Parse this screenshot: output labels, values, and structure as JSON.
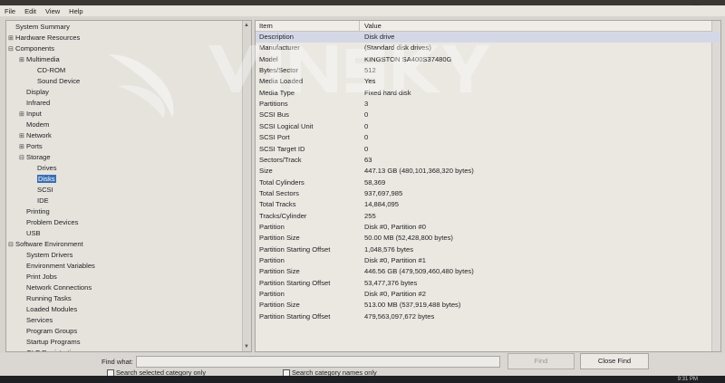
{
  "menu": [
    "File",
    "Edit",
    "View",
    "Help"
  ],
  "tree": [
    {
      "label": "System Summary",
      "level": 0,
      "exp": ""
    },
    {
      "label": "Hardware Resources",
      "level": 0,
      "exp": "⊞"
    },
    {
      "label": "Components",
      "level": 0,
      "exp": "⊟"
    },
    {
      "label": "Multimedia",
      "level": 1,
      "exp": "⊞"
    },
    {
      "label": "CD-ROM",
      "level": 2,
      "exp": ""
    },
    {
      "label": "Sound Device",
      "level": 2,
      "exp": ""
    },
    {
      "label": "Display",
      "level": 1,
      "exp": ""
    },
    {
      "label": "Infrared",
      "level": 1,
      "exp": ""
    },
    {
      "label": "Input",
      "level": 1,
      "exp": "⊞"
    },
    {
      "label": "Modem",
      "level": 1,
      "exp": ""
    },
    {
      "label": "Network",
      "level": 1,
      "exp": "⊞"
    },
    {
      "label": "Ports",
      "level": 1,
      "exp": "⊞"
    },
    {
      "label": "Storage",
      "level": 1,
      "exp": "⊟"
    },
    {
      "label": "Drives",
      "level": 2,
      "exp": ""
    },
    {
      "label": "Disks",
      "level": 2,
      "exp": "",
      "selected": true
    },
    {
      "label": "SCSI",
      "level": 2,
      "exp": ""
    },
    {
      "label": "IDE",
      "level": 2,
      "exp": ""
    },
    {
      "label": "Printing",
      "level": 1,
      "exp": ""
    },
    {
      "label": "Problem Devices",
      "level": 1,
      "exp": ""
    },
    {
      "label": "USB",
      "level": 1,
      "exp": ""
    },
    {
      "label": "Software Environment",
      "level": 0,
      "exp": "⊟"
    },
    {
      "label": "System Drivers",
      "level": 1,
      "exp": ""
    },
    {
      "label": "Environment Variables",
      "level": 1,
      "exp": ""
    },
    {
      "label": "Print Jobs",
      "level": 1,
      "exp": ""
    },
    {
      "label": "Network Connections",
      "level": 1,
      "exp": ""
    },
    {
      "label": "Running Tasks",
      "level": 1,
      "exp": ""
    },
    {
      "label": "Loaded Modules",
      "level": 1,
      "exp": ""
    },
    {
      "label": "Services",
      "level": 1,
      "exp": ""
    },
    {
      "label": "Program Groups",
      "level": 1,
      "exp": ""
    },
    {
      "label": "Startup Programs",
      "level": 1,
      "exp": ""
    },
    {
      "label": "OLE Registration",
      "level": 1,
      "exp": ""
    }
  ],
  "list": {
    "headers": {
      "item": "Item",
      "value": "Value"
    },
    "rows": [
      {
        "item": "Description",
        "value": "Disk drive",
        "selected": true
      },
      {
        "item": "Manufacturer",
        "value": "(Standard disk drives)"
      },
      {
        "item": "Model",
        "value": "KINGSTON SA400S37480G"
      },
      {
        "item": "Bytes/Sector",
        "value": "512"
      },
      {
        "item": "Media Loaded",
        "value": "Yes"
      },
      {
        "item": "Media Type",
        "value": "Fixed hard disk"
      },
      {
        "item": "Partitions",
        "value": "3"
      },
      {
        "item": "SCSI Bus",
        "value": "0"
      },
      {
        "item": "SCSI Logical Unit",
        "value": "0"
      },
      {
        "item": "SCSI Port",
        "value": "0"
      },
      {
        "item": "SCSI Target ID",
        "value": "0"
      },
      {
        "item": "Sectors/Track",
        "value": "63"
      },
      {
        "item": "Size",
        "value": "447.13 GB (480,101,368,320 bytes)"
      },
      {
        "item": "Total Cylinders",
        "value": "58,369"
      },
      {
        "item": "Total Sectors",
        "value": "937,697,985"
      },
      {
        "item": "Total Tracks",
        "value": "14,884,095"
      },
      {
        "item": "Tracks/Cylinder",
        "value": "255"
      },
      {
        "item": "Partition",
        "value": "Disk #0, Partition #0"
      },
      {
        "item": "Partition Size",
        "value": "50.00 MB (52,428,800 bytes)"
      },
      {
        "item": "Partition Starting Offset",
        "value": "1,048,576 bytes"
      },
      {
        "item": "Partition",
        "value": "Disk #0, Partition #1"
      },
      {
        "item": "Partition Size",
        "value": "446.56 GB (479,509,460,480 bytes)"
      },
      {
        "item": "Partition Starting Offset",
        "value": "53,477,376 bytes"
      },
      {
        "item": "Partition",
        "value": "Disk #0, Partition #2"
      },
      {
        "item": "Partition Size",
        "value": "513.00 MB (537,919,488 bytes)"
      },
      {
        "item": "Partition Starting Offset",
        "value": "479,563,097,672 bytes"
      }
    ]
  },
  "find": {
    "label": "Find what:",
    "find_button": "Find",
    "close_button": "Close Find",
    "search_selected": "Search selected category only",
    "search_names": "Search category names only"
  },
  "taskbar": {
    "clock": "9:31 PM"
  },
  "colors": {
    "selection": "#3b6fb3",
    "window_bg": "#e6e3dd"
  }
}
